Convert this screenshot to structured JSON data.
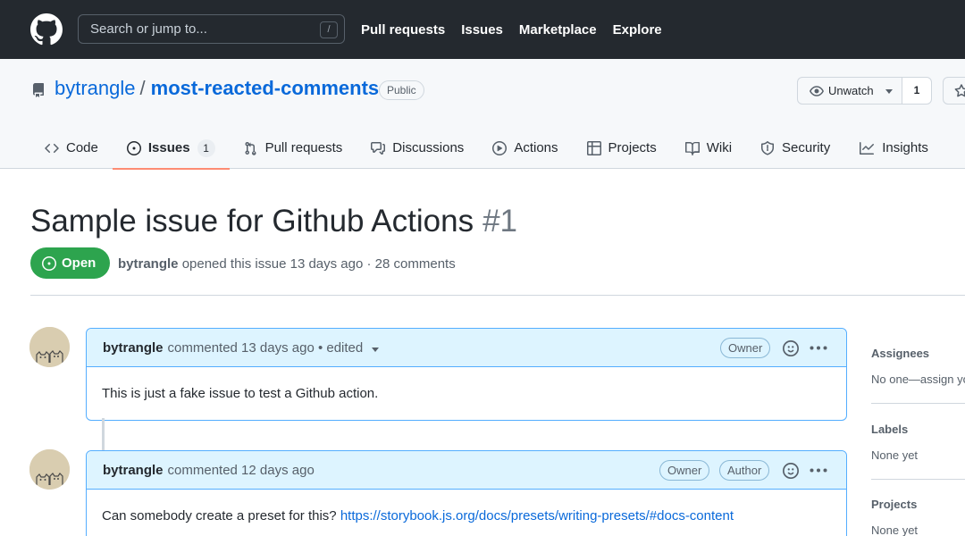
{
  "header": {
    "search_placeholder": "Search or jump to...",
    "search_shortcut": "/",
    "nav": [
      "Pull requests",
      "Issues",
      "Marketplace",
      "Explore"
    ]
  },
  "repo": {
    "owner": "bytrangle",
    "separator": "/",
    "name": "most-reacted-comments",
    "visibility": "Public",
    "watch_label": "Unwatch",
    "watch_count": "1",
    "tabs": [
      {
        "label": "Code",
        "icon": "code-icon"
      },
      {
        "label": "Issues",
        "icon": "issue-opened-icon",
        "count": "1",
        "selected": true
      },
      {
        "label": "Pull requests",
        "icon": "git-pull-request-icon"
      },
      {
        "label": "Discussions",
        "icon": "comment-discussion-icon"
      },
      {
        "label": "Actions",
        "icon": "play-icon"
      },
      {
        "label": "Projects",
        "icon": "table-icon"
      },
      {
        "label": "Wiki",
        "icon": "book-icon"
      },
      {
        "label": "Security",
        "icon": "shield-icon"
      },
      {
        "label": "Insights",
        "icon": "graph-icon"
      }
    ]
  },
  "issue": {
    "title": "Sample issue for Github Actions",
    "number": "#1",
    "state": "Open",
    "author": "bytrangle",
    "meta": "opened this issue 13 days ago · 28 comments"
  },
  "comments": [
    {
      "author": "bytrangle",
      "meta": "commented 13 days ago • edited",
      "roles": [
        "Owner"
      ],
      "body": "This is just a fake issue to test a Github action."
    },
    {
      "author": "bytrangle",
      "meta": "commented 12 days ago",
      "roles": [
        "Owner",
        "Author"
      ],
      "body": "Can somebody create a preset for this?",
      "link": "https://storybook.js.org/docs/presets/writing-presets/#docs-content"
    }
  ],
  "sidebar": {
    "assignees_label": "Assignees",
    "assignees_value": "No one—assign yourself",
    "labels_label": "Labels",
    "labels_value": "None yet",
    "projects_label": "Projects",
    "projects_value": "None yet"
  },
  "colors": {
    "header_bg": "#24292f",
    "link": "#0969da",
    "open_green": "#2da44e",
    "tab_underline": "#fd8c73",
    "comment_border": "#54aeff",
    "comment_head_bg": "#ddf4ff"
  }
}
